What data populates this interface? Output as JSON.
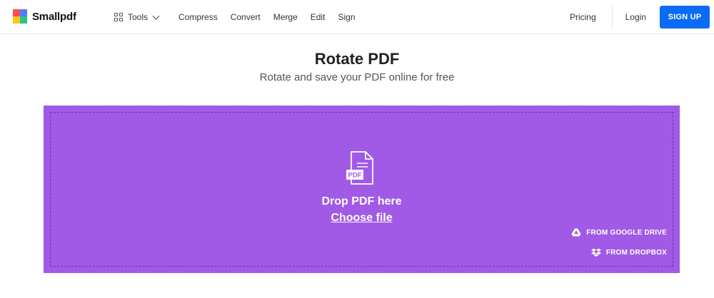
{
  "header": {
    "logo_text": "Smallpdf",
    "logo_colors": [
      "#ff4d4d",
      "#4d7fff",
      "#ffc31e",
      "#2ec27e"
    ],
    "tools_label": "Tools",
    "nav_links": [
      "Compress",
      "Convert",
      "Merge",
      "Edit",
      "Sign"
    ],
    "pricing_label": "Pricing",
    "login_label": "Login",
    "signup_label": "SIGN UP"
  },
  "main": {
    "title": "Rotate PDF",
    "subtitle": "Rotate and save your PDF online for free"
  },
  "dropzone": {
    "accent_color": "#a05ae6",
    "file_icon_badge": "PDF",
    "drop_text": "Drop PDF here",
    "choose_file_label": "Choose file",
    "google_drive_label": "FROM GOOGLE DRIVE",
    "dropbox_label": "FROM DROPBOX"
  },
  "colors": {
    "signup_button": "#0a6cf5"
  }
}
